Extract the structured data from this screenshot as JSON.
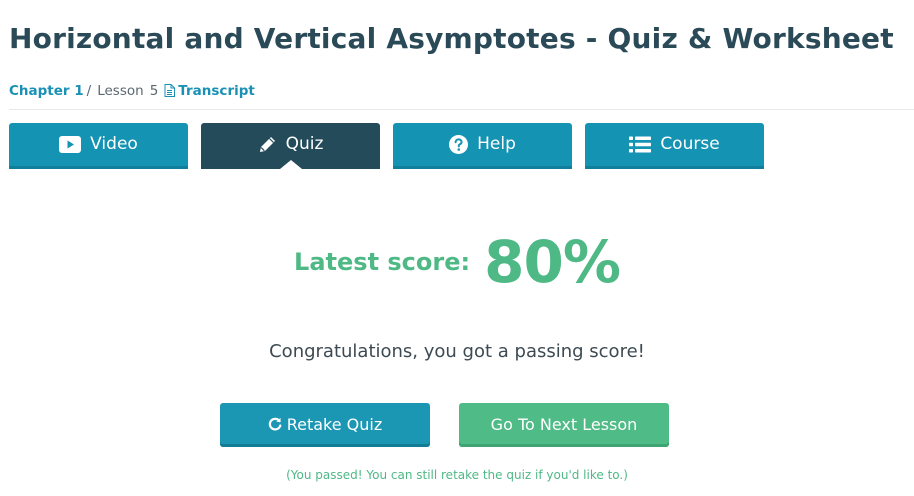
{
  "page": {
    "title": "Horizontal and Vertical Asymptotes - Quiz & Worksheet"
  },
  "breadcrumb": {
    "chapter": "Chapter 1",
    "separator": "/",
    "lesson": "Lesson",
    "lesson_number": "5",
    "transcript": "Transcript",
    "transcript_icon": "document-icon"
  },
  "tabs": [
    {
      "label": "Video",
      "icon": "play-icon",
      "active": false
    },
    {
      "label": "Quiz",
      "icon": "pencil-icon",
      "active": true
    },
    {
      "label": "Help",
      "icon": "question-circle-icon",
      "active": false
    },
    {
      "label": "Course",
      "icon": "list-icon",
      "active": false
    }
  ],
  "result": {
    "score_label": "Latest score:",
    "score_value": "80%",
    "message": "Congratulations, you got a passing score!"
  },
  "actions": {
    "retake_label": "Retake Quiz",
    "retake_icon": "refresh-icon",
    "next_label": "Go To Next Lesson"
  },
  "note": "(You passed! You can still retake the quiz if you'd like to.)",
  "colors": {
    "title": "#2b4a58",
    "tab": "#1593b3",
    "tab_active": "#244b5a",
    "success": "#4fb986",
    "link": "#1a91b4"
  }
}
